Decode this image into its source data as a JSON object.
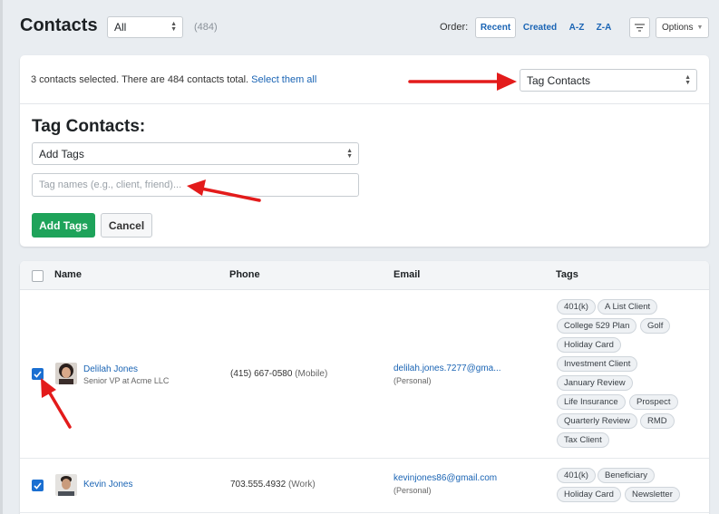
{
  "header": {
    "title": "Contacts",
    "filter_value": "All",
    "count": "(484)",
    "order_label": "Order:",
    "order_options": [
      "Recent",
      "Created",
      "A-Z",
      "Z-A"
    ],
    "options_label": "Options"
  },
  "bulk": {
    "selection_text": "3 contacts selected. There are 484 contacts total.",
    "select_all_link": "Select them all",
    "action_value": "Tag Contacts",
    "heading": "Tag Contacts:",
    "mode_value": "Add Tags",
    "tag_placeholder": "Tag names (e.g., client, friend)...",
    "add_button": "Add Tags",
    "cancel_button": "Cancel"
  },
  "table": {
    "columns": [
      "Name",
      "Phone",
      "Email",
      "Tags"
    ],
    "rows": [
      {
        "checked": true,
        "name": "Delilah Jones",
        "title": "Senior VP at Acme LLC",
        "phone": "(415) 667-0580",
        "phone_type": "(Mobile)",
        "email": "delilah.jones.7277@gma...",
        "email_type": "(Personal)",
        "tags": [
          "401(k)",
          "A List Client",
          "College 529 Plan",
          "Golf",
          "Holiday Card",
          "Investment Client",
          "January Review",
          "Life Insurance",
          "Prospect",
          "Quarterly Review",
          "RMD",
          "Tax Client"
        ]
      },
      {
        "checked": true,
        "name": "Kevin Jones",
        "title": "",
        "phone": "703.555.4932",
        "phone_type": "(Work)",
        "email": "kevinjones86@gmail.com",
        "email_type": "(Personal)",
        "tags": [
          "401(k)",
          "Beneficiary",
          "Holiday Card",
          "Newsletter"
        ]
      }
    ]
  },
  "colors": {
    "accent_blue": "#1a64b4",
    "checkbox_blue": "#1a6fd1",
    "success_green": "#1ea35a",
    "annotation_red": "#e31b1b"
  }
}
